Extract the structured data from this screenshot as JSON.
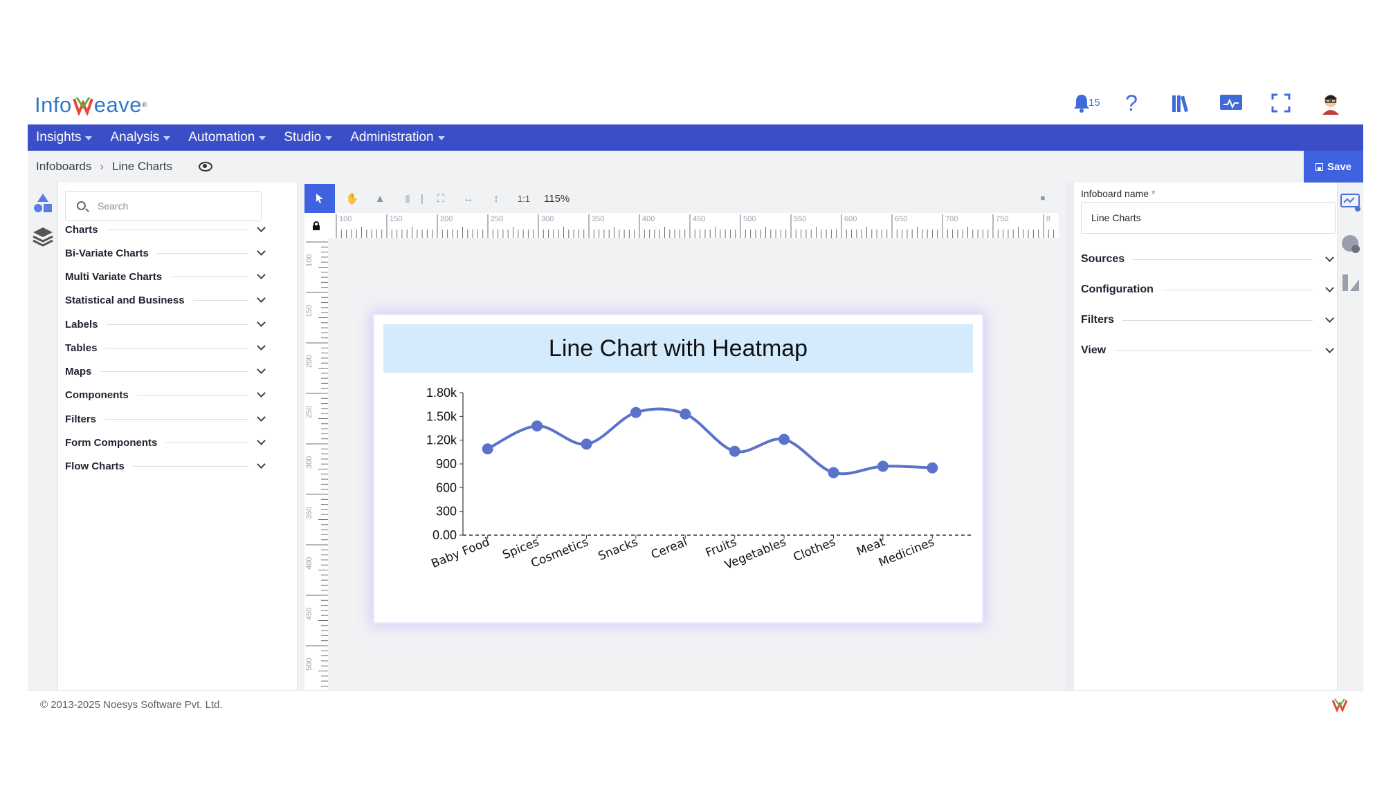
{
  "brand": {
    "logo_prefix": "Info",
    "logo_suffix": "eave",
    "logo_mark": "W",
    "registered": "®"
  },
  "header": {
    "notifications_count": "15",
    "icons": [
      "bell-icon",
      "help-icon",
      "library-icon",
      "monitor-icon",
      "fullscreen-icon",
      "user-avatar"
    ]
  },
  "nav": {
    "items": [
      "Insights",
      "Analysis",
      "Automation",
      "Studio",
      "Administration"
    ]
  },
  "breadcrumb": {
    "root": "Infoboards",
    "current": "Line Charts",
    "save_label": "Save"
  },
  "left_panel": {
    "search_placeholder": "Search",
    "categories": [
      "Charts",
      "Bi-Variate Charts",
      "Multi Variate Charts",
      "Statistical and Business",
      "Labels",
      "Tables",
      "Maps",
      "Components",
      "Filters",
      "Form Components",
      "Flow Charts"
    ]
  },
  "toolbar": {
    "ratio_label": "1:1",
    "zoom": "115%"
  },
  "ruler": {
    "h_ticks": [
      "100",
      "150",
      "200",
      "250",
      "300",
      "350",
      "400",
      "450",
      "500",
      "550",
      "600",
      "650",
      "700",
      "750",
      "8"
    ],
    "v_ticks": [
      "100",
      "150",
      "200",
      "250",
      "300",
      "350",
      "400",
      "450",
      "500"
    ]
  },
  "right_panel": {
    "name_label": "Infoboard name",
    "required_mark": "*",
    "name_value": "Line Charts",
    "sections": [
      "Sources",
      "Configuration",
      "Filters",
      "View"
    ]
  },
  "footer": {
    "copyright": "© 2013-2025 Noesys Software Pvt. Ltd."
  },
  "colors": {
    "nav": "#3a4fc7",
    "accent": "#3f63e0",
    "line": "#5a72c9",
    "title_bg": "#d3ebfd"
  },
  "chart_data": {
    "type": "line",
    "title": "Line Chart with Heatmap",
    "categories": [
      "Baby Food",
      "Spices",
      "Cosmetics",
      "Snacks",
      "Cereal",
      "Fruits",
      "Vegetables",
      "Clothes",
      "Meat",
      "Medicines"
    ],
    "values": [
      1090,
      1380,
      1150,
      1550,
      1530,
      1060,
      1210,
      790,
      870,
      850
    ],
    "y_ticks": [
      "0.00",
      "300",
      "600",
      "900",
      "1.20k",
      "1.50k",
      "1.80k"
    ],
    "ylim": [
      0,
      1800
    ],
    "curve": "smooth",
    "grid": false,
    "xlabel": "",
    "ylabel": ""
  }
}
